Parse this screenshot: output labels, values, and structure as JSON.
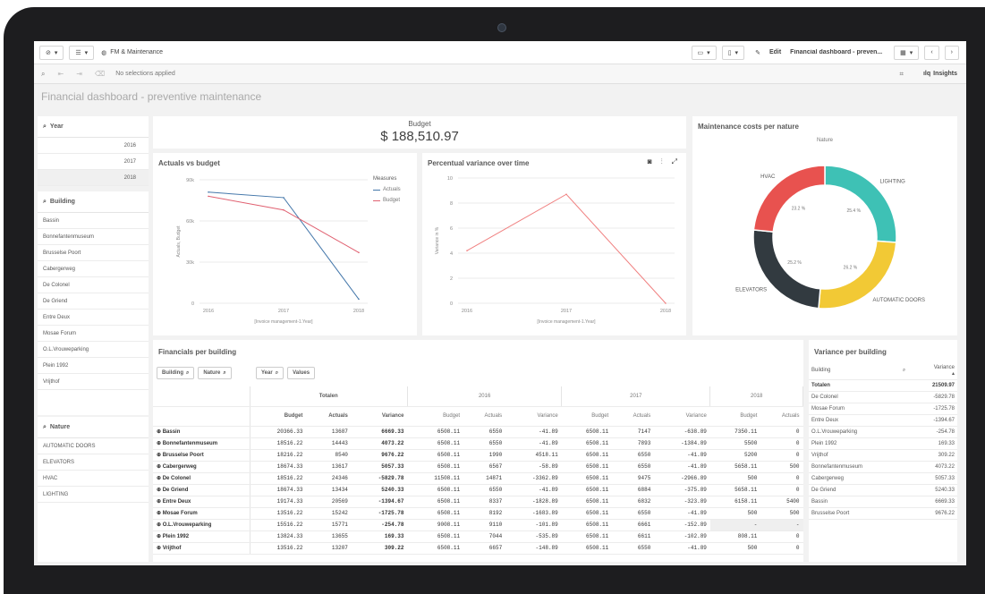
{
  "toolbar": {
    "app_title": "FM & Maintenance",
    "edit_label": "Edit",
    "sheet_name": "Financial dashboard - preven...",
    "insights_label": "Insights",
    "selections_text": "No selections applied"
  },
  "sheet_title": "Financial dashboard - preventive maintenance",
  "filters": {
    "year": {
      "label": "Year",
      "items": [
        "2016",
        "2017",
        "2018"
      ]
    },
    "building": {
      "label": "Building",
      "items": [
        "Bassin",
        "Bonnefantenmuseum",
        "Brusselse Poort",
        "Cabergerweg",
        "De Colonel",
        "De Griend",
        "Entre Deux",
        "Mosae Forum",
        "O.L.Vrouweparking",
        "Plein 1992",
        "Vrijthof"
      ]
    },
    "nature": {
      "label": "Nature",
      "items": [
        "AUTOMATIC DOORS",
        "ELEVATORS",
        "HVAC",
        "LIGHTING"
      ]
    }
  },
  "kpi": {
    "label": "Budget",
    "value": "$ 188,510.97"
  },
  "actuals_chart": {
    "title": "Actuals vs budget",
    "legend_title": "Measures",
    "ylabel": "Actuals, Budget",
    "xlabel": "[Invoice management-1.Year]",
    "y_ticks": [
      "90k",
      "60k",
      "30k",
      "0"
    ],
    "colors": {
      "actuals": "#4477aa",
      "budget": "#e06070"
    }
  },
  "variance_chart": {
    "title": "Percentual variance over time",
    "ylabel": "Variance in %",
    "xlabel": "[Invoice management-1.Year]",
    "y_ticks": [
      "10",
      "8",
      "6",
      "4",
      "2",
      "0"
    ],
    "color": "#f08080"
  },
  "donut_chart": {
    "title": "Maintenance costs per nature",
    "center_title": "Nature",
    "slice_values": [
      "25.4 %",
      "26.2 %",
      "25.2 %",
      "23.2 %"
    ]
  },
  "chart_data": [
    {
      "type": "line",
      "title": "Actuals vs budget",
      "x": [
        "2016",
        "2017",
        "2018"
      ],
      "series": [
        {
          "name": "Actuals",
          "values": [
            81000,
            77000,
            3000
          ]
        },
        {
          "name": "Budget",
          "values": [
            78000,
            68000,
            37000
          ]
        }
      ],
      "xlabel": "[Invoice management-1.Year]",
      "ylabel": "Actuals, Budget",
      "ylim": [
        0,
        90000
      ],
      "legend": "right"
    },
    {
      "type": "line",
      "title": "Percentual variance over time",
      "x": [
        "2016",
        "2017",
        "2018"
      ],
      "series": [
        {
          "values": [
            4.2,
            8.7,
            0
          ]
        }
      ],
      "xlabel": "[Invoice management-1.Year]",
      "ylabel": "Variance in %",
      "ylim": [
        0,
        10
      ]
    },
    {
      "type": "pie",
      "title": "Maintenance costs per nature",
      "categories": [
        "LIGHTING",
        "AUTOMATIC DOORS",
        "ELEVATORS",
        "HVAC"
      ],
      "values": [
        26.2,
        25.2,
        25.2,
        23.4
      ],
      "colors": [
        "#3ec1b5",
        "#f2c935",
        "#323a40",
        "#e8524f"
      ]
    }
  ],
  "financials": {
    "title": "Financials per building",
    "buttons": [
      "Building",
      "Nature",
      "Year",
      "Values"
    ],
    "group_headers": [
      "Totalen",
      "2016",
      "2017",
      "2018"
    ],
    "columns": [
      "Budget",
      "Actuals",
      "Variance",
      "Budget",
      "Actuals",
      "Variance",
      "Budget",
      "Actuals",
      "Variance",
      "Budget",
      "Actuals"
    ],
    "rows": [
      {
        "name": "Bassin",
        "cells": [
          "20366.33",
          "13687",
          "6669.33",
          "6508.11",
          "6550",
          "-41.89",
          "6508.11",
          "7147",
          "-638.89",
          "7350.11",
          "0"
        ]
      },
      {
        "name": "Bonnefantenmuseum",
        "cells": [
          "18516.22",
          "14443",
          "4073.22",
          "6508.11",
          "6550",
          "-41.89",
          "6508.11",
          "7893",
          "-1384.89",
          "5500",
          "0"
        ]
      },
      {
        "name": "Brusselse Poort",
        "cells": [
          "18216.22",
          "8540",
          "9676.22",
          "6508.11",
          "1990",
          "4518.11",
          "6508.11",
          "6550",
          "-41.89",
          "5200",
          "0"
        ]
      },
      {
        "name": "Cabergerweg",
        "cells": [
          "18674.33",
          "13617",
          "5057.33",
          "6508.11",
          "6567",
          "-58.89",
          "6508.11",
          "6550",
          "-41.89",
          "5658.11",
          "500"
        ]
      },
      {
        "name": "De Colonel",
        "cells": [
          "18516.22",
          "24346",
          "-5829.78",
          "11508.11",
          "14871",
          "-3362.89",
          "6508.11",
          "9475",
          "-2966.89",
          "500",
          "0"
        ]
      },
      {
        "name": "De Griend",
        "cells": [
          "18674.33",
          "13434",
          "5240.33",
          "6508.11",
          "6550",
          "-41.89",
          "6508.11",
          "6884",
          "-375.89",
          "5658.11",
          "0"
        ]
      },
      {
        "name": "Entre Deux",
        "cells": [
          "19174.33",
          "20569",
          "-1394.67",
          "6508.11",
          "8337",
          "-1828.89",
          "6508.11",
          "6832",
          "-323.89",
          "6158.11",
          "5400"
        ]
      },
      {
        "name": "Mosae Forum",
        "cells": [
          "13516.22",
          "15242",
          "-1725.78",
          "6508.11",
          "8192",
          "-1683.89",
          "6508.11",
          "6550",
          "-41.89",
          "500",
          "500"
        ]
      },
      {
        "name": "O.L.Vrouweparking",
        "cells": [
          "15516.22",
          "15771",
          "-254.78",
          "9008.11",
          "9110",
          "-101.89",
          "6508.11",
          "6661",
          "-152.89",
          "-",
          "-"
        ]
      },
      {
        "name": "Plein 1992",
        "cells": [
          "13824.33",
          "13655",
          "169.33",
          "6508.11",
          "7044",
          "-535.89",
          "6508.11",
          "6611",
          "-102.89",
          "808.11",
          "0"
        ]
      },
      {
        "name": "Vrijthof",
        "cells": [
          "13516.22",
          "13207",
          "309.22",
          "6508.11",
          "6657",
          "-148.89",
          "6508.11",
          "6550",
          "-41.89",
          "500",
          "0"
        ]
      }
    ]
  },
  "variance_building": {
    "title": "Variance per building",
    "col_building": "Building",
    "col_variance": "Variance",
    "totals_label": "Totalen",
    "totals_value": "21509.97",
    "rows": [
      {
        "name": "De Colonel",
        "value": "-5829.78"
      },
      {
        "name": "Mosae Forum",
        "value": "-1725.78"
      },
      {
        "name": "Entre Deux",
        "value": "-1394.67"
      },
      {
        "name": "O.L.Vrouweparking",
        "value": "-254.78"
      },
      {
        "name": "Plein 1992",
        "value": "169.33"
      },
      {
        "name": "Vrijthof",
        "value": "309.22"
      },
      {
        "name": "Bonnefantenmuseum",
        "value": "4073.22"
      },
      {
        "name": "Cabergerweg",
        "value": "5057.33"
      },
      {
        "name": "De Griend",
        "value": "5240.33"
      },
      {
        "name": "Bassin",
        "value": "6669.33"
      },
      {
        "name": "Brusselse Poort",
        "value": "9676.22"
      }
    ]
  }
}
